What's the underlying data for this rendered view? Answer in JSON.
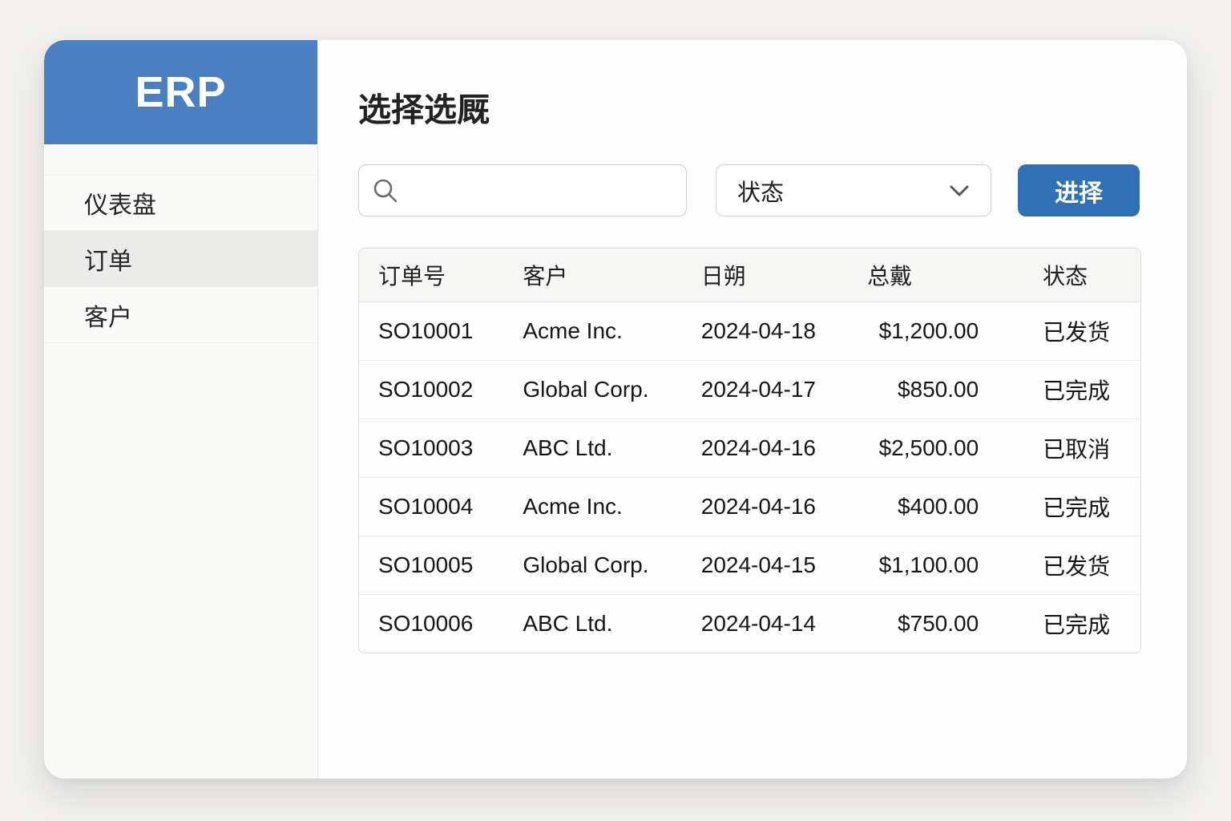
{
  "colors": {
    "accent_blue": "#4a80c2",
    "button_blue": "#3070b4"
  },
  "app": {
    "logo": "ERP"
  },
  "sidebar": {
    "items": [
      {
        "label": "仪表盘",
        "active": false
      },
      {
        "label": "订单",
        "active": true
      },
      {
        "label": "客户",
        "active": false
      }
    ]
  },
  "main": {
    "title": "选择选厩",
    "toolbar": {
      "search_value": "",
      "search_placeholder": "",
      "status_dropdown_label": "状态",
      "select_button_label": "进择"
    },
    "table": {
      "headers": [
        "订单号",
        "客户",
        "日朔",
        "总戴",
        "状态"
      ],
      "rows": [
        {
          "order_no": "SO10001",
          "customer": "Acme Inc.",
          "date": "2024-04-18",
          "amount": "$1,200.00",
          "status": "已发货"
        },
        {
          "order_no": "SO10002",
          "customer": "Global Corp.",
          "date": "2024-04-17",
          "amount": "$850.00",
          "status": "已完成"
        },
        {
          "order_no": "SO10003",
          "customer": "ABC Ltd.",
          "date": "2024-04-16",
          "amount": "$2,500.00",
          "status": "已取消"
        },
        {
          "order_no": "SO10004",
          "customer": "Acme Inc.",
          "date": "2024-04-16",
          "amount": "$400.00",
          "status": "已完成"
        },
        {
          "order_no": "SO10005",
          "customer": "Global Corp.",
          "date": "2024-04-15",
          "amount": "$1,100.00",
          "status": "已发货"
        },
        {
          "order_no": "SO10006",
          "customer": "ABC Ltd.",
          "date": "2024-04-14",
          "amount": "$750.00",
          "status": "已完成"
        }
      ]
    }
  }
}
